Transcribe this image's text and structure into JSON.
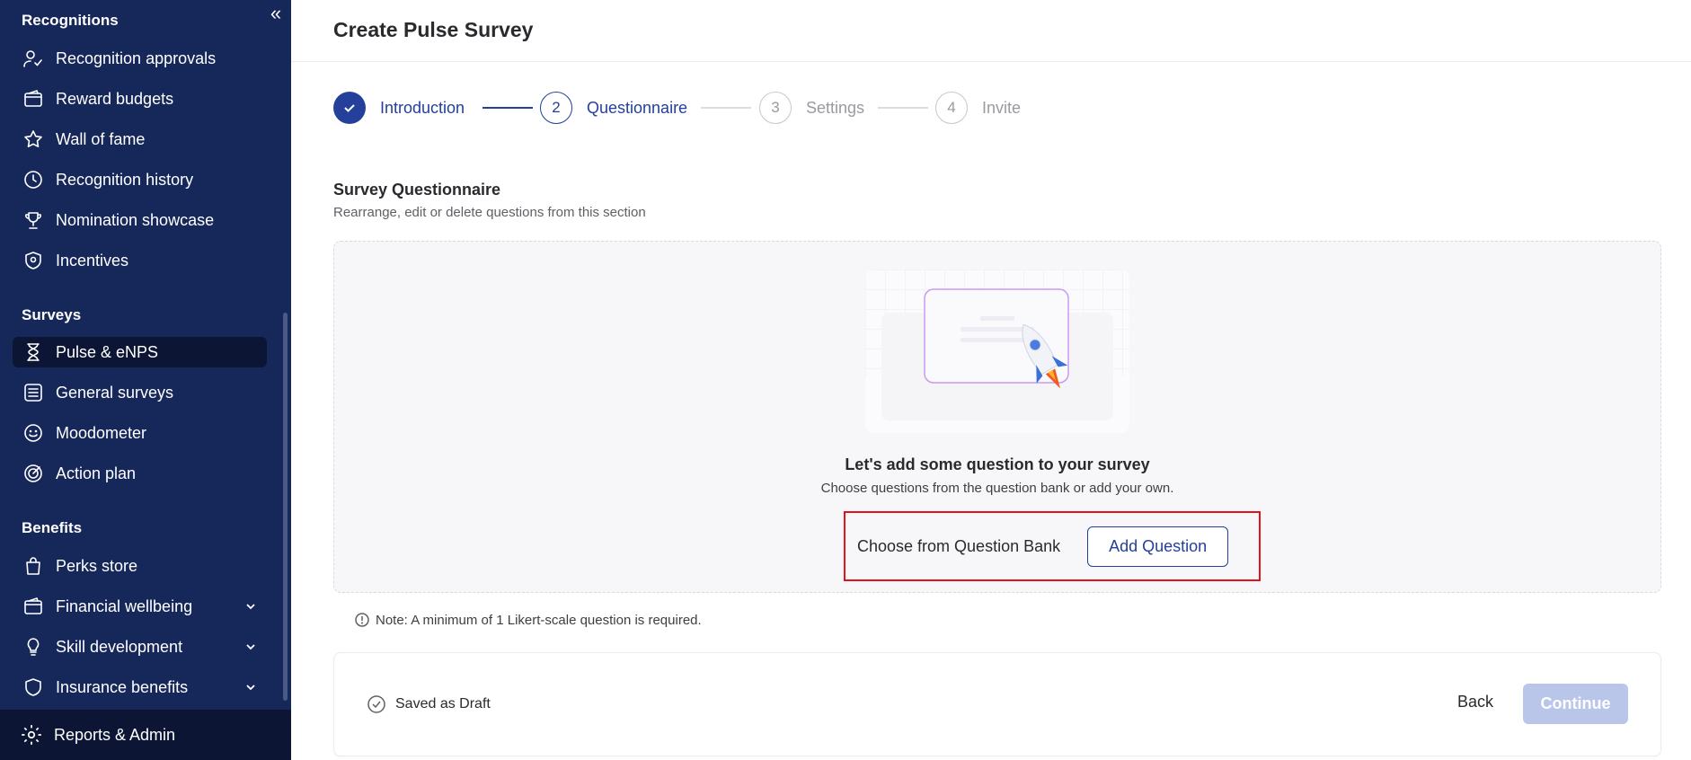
{
  "sidebar": {
    "sections": [
      {
        "title": "Recognitions",
        "items": [
          {
            "label": "Recognition approvals",
            "icon": "user-check-icon"
          },
          {
            "label": "Reward budgets",
            "icon": "wallet-icon"
          },
          {
            "label": "Wall of fame",
            "icon": "star-icon"
          },
          {
            "label": "Recognition history",
            "icon": "clock-icon"
          },
          {
            "label": "Nomination showcase",
            "icon": "trophy-icon"
          },
          {
            "label": "Incentives",
            "icon": "shield-icon"
          }
        ]
      },
      {
        "title": "Surveys",
        "items": [
          {
            "label": "Pulse & eNPS",
            "icon": "hourglass-icon",
            "active": true
          },
          {
            "label": "General surveys",
            "icon": "list-icon"
          },
          {
            "label": "Moodometer",
            "icon": "smile-icon"
          },
          {
            "label": "Action plan",
            "icon": "target-icon"
          }
        ]
      },
      {
        "title": "Benefits",
        "items": [
          {
            "label": "Perks store",
            "icon": "bag-icon"
          },
          {
            "label": "Financial wellbeing",
            "icon": "wallet-icon",
            "expandable": true
          },
          {
            "label": "Skill development",
            "icon": "bulb-icon",
            "expandable": true
          },
          {
            "label": "Insurance benefits",
            "icon": "shield-icon",
            "expandable": true
          }
        ]
      }
    ],
    "footer": {
      "label": "Reports & Admin",
      "icon": "gear-icon"
    }
  },
  "header": {
    "title": "Create Pulse Survey"
  },
  "stepper": {
    "steps": [
      {
        "number": "1",
        "label": "Introduction",
        "state": "done"
      },
      {
        "number": "2",
        "label": "Questionnaire",
        "state": "current"
      },
      {
        "number": "3",
        "label": "Settings",
        "state": "pending"
      },
      {
        "number": "4",
        "label": "Invite",
        "state": "pending"
      }
    ]
  },
  "questionnaire": {
    "title": "Survey Questionnaire",
    "subtitle": "Rearrange, edit or delete questions from this section",
    "empty_title": "Let's add some question to your survey",
    "empty_subtitle": "Choose questions from the question bank or add your own.",
    "choose_label": "Choose from Question Bank",
    "add_label": "Add Question"
  },
  "note": {
    "text": "Note: A minimum of 1 Likert-scale question is required."
  },
  "footer": {
    "saved_label": "Saved as Draft",
    "back_label": "Back",
    "continue_label": "Continue"
  },
  "colors": {
    "sidebar_bg": "#16285a",
    "accent": "#24409a",
    "highlight": "#e0151b",
    "disabled_btn": "#b9c6e9"
  }
}
